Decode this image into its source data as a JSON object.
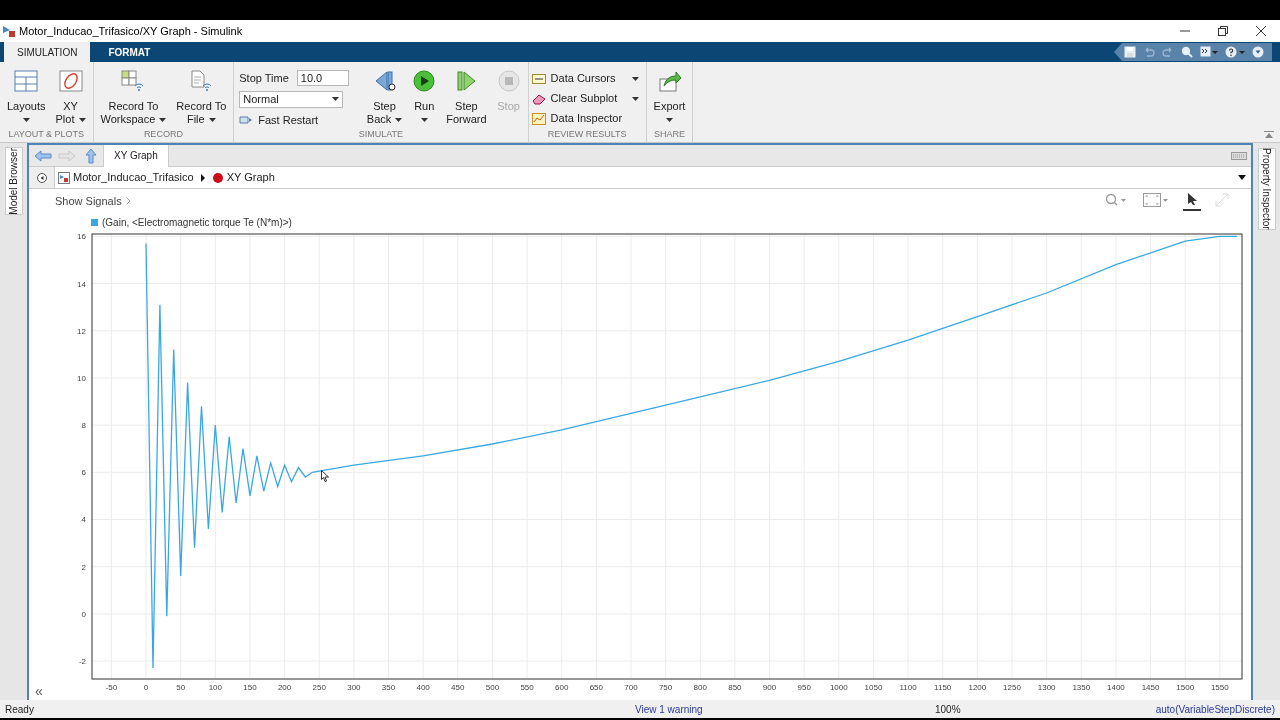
{
  "window": {
    "title": "Motor_Inducao_Trifasico/XY Graph - Simulink"
  },
  "ribbon_tabs": [
    {
      "label": "SIMULATION",
      "selected": true
    },
    {
      "label": "FORMAT",
      "selected": false
    }
  ],
  "quick_access": [
    {
      "disabled": false
    },
    {
      "disabled": true
    },
    {
      "disabled": true
    },
    {
      "disabled": false
    },
    {
      "disabled": false
    },
    {
      "disabled": false
    },
    {
      "disabled": false
    }
  ],
  "toolstrip": [
    {
      "label": "LAYOUT & PLOTS",
      "controls": [
        {
          "kind": "large",
          "lines": [
            "Layouts"
          ],
          "menu": true,
          "disabled": false
        },
        {
          "kind": "large",
          "lines": [
            "XY",
            "Plot"
          ],
          "menu": true,
          "disabled": false
        }
      ]
    },
    {
      "label": "RECORD",
      "controls": [
        {
          "kind": "large",
          "lines": [
            "Record To",
            "Workspace"
          ],
          "menu": true,
          "disabled": false
        },
        {
          "kind": "large",
          "lines": [
            "Record To",
            "File"
          ],
          "menu": true,
          "disabled": false
        }
      ]
    },
    {
      "label": "SIMULATE",
      "controls": [
        {
          "kind": "settings",
          "stop_time_label": "Stop Time",
          "stop_time": "10.0",
          "mode": "Normal",
          "fast_restart": "Fast Restart"
        },
        {
          "kind": "large",
          "lines": [
            "Step",
            "Back"
          ],
          "menu": true,
          "disabled": false
        },
        {
          "kind": "large",
          "lines": [
            "Run"
          ],
          "menu": true,
          "disabled": false
        },
        {
          "kind": "large",
          "lines": [
            "Step",
            "Forward"
          ],
          "menu": false,
          "disabled": false
        },
        {
          "kind": "large",
          "lines": [
            "Stop"
          ],
          "menu": false,
          "disabled": true
        }
      ]
    },
    {
      "label": "REVIEW RESULTS",
      "controls": [
        {
          "kind": "small",
          "label": "Data Cursors",
          "menu": true
        },
        {
          "kind": "small",
          "label": "Clear Subplot",
          "menu": true
        },
        {
          "kind": "small",
          "label": "Data Inspector",
          "menu": false
        }
      ]
    },
    {
      "label": "SHARE",
      "controls": [
        {
          "kind": "large",
          "lines": [
            "Export"
          ],
          "menu": true,
          "disabled": false
        }
      ]
    }
  ],
  "side_panels": {
    "left": "Model Browser",
    "right": "Property Inspector"
  },
  "editor_tabs": [
    {
      "label": "XY Graph",
      "selected": true
    }
  ],
  "breadcrumb": [
    "Motor_Inducao_Trifasico",
    "XY Graph"
  ],
  "plot": {
    "show_signals": "Show Signals",
    "plot_toolbar": [
      {
        "selected": false,
        "disabled": false
      },
      {
        "selected": false,
        "disabled": false
      },
      {
        "selected": true,
        "disabled": false
      },
      {
        "selected": false,
        "disabled": true
      }
    ],
    "chart_data": {
      "type": "line",
      "grid": true,
      "xlim": [
        -78,
        1582
      ],
      "ylim": [
        -2.76,
        16.1
      ],
      "xticks": [
        -50,
        0,
        50,
        100,
        150,
        200,
        250,
        300,
        350,
        400,
        450,
        500,
        550,
        600,
        650,
        700,
        750,
        800,
        850,
        900,
        950,
        1000,
        1050,
        1100,
        1150,
        1200,
        1250,
        1300,
        1350,
        1400,
        1450,
        1500,
        1550
      ],
      "yticks": [
        -2,
        0,
        2,
        4,
        6,
        8,
        10,
        12,
        14,
        16
      ],
      "x": [
        0,
        10,
        20,
        30,
        40,
        50,
        60,
        70,
        80,
        90,
        100,
        110,
        120,
        130,
        140,
        150,
        160,
        170,
        180,
        190,
        200,
        210,
        220,
        230,
        240,
        250,
        300,
        400,
        500,
        600,
        700,
        800,
        900,
        1000,
        1100,
        1200,
        1300,
        1400,
        1500,
        1550,
        1575
      ],
      "series": [
        {
          "name": "(Gain, <Electromagnetic torque Te (N*m)>)",
          "color": "#3aa8e0",
          "values": [
            15.7,
            -2.3,
            13.1,
            -0.1,
            11.2,
            1.6,
            9.8,
            2.8,
            8.8,
            3.6,
            8.0,
            4.3,
            7.5,
            4.7,
            7.0,
            5.0,
            6.7,
            5.2,
            6.4,
            5.4,
            6.3,
            5.6,
            6.2,
            5.8,
            6.0,
            6.05,
            6.3,
            6.7,
            7.2,
            7.8,
            8.5,
            9.2,
            9.9,
            10.7,
            11.6,
            12.6,
            13.6,
            14.8,
            15.8,
            16.0,
            16.0
          ]
        }
      ]
    },
    "collapse": "«"
  },
  "status_bar": {
    "state": "Ready",
    "warning": "View 1 warning",
    "zoom": "100%",
    "solver": "auto(VariableStepDiscrete)"
  }
}
